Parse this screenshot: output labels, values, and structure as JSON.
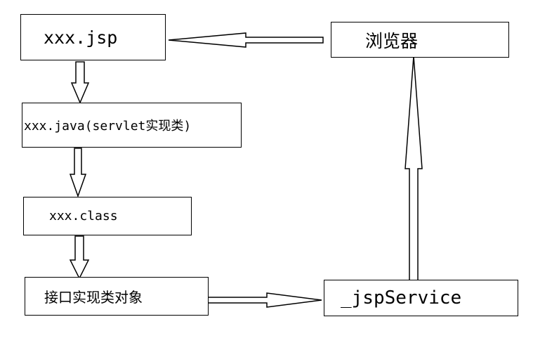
{
  "nodes": {
    "jsp": "xxx.jsp",
    "java": "xxx.java(servlet实现类)",
    "class": "xxx.class",
    "interface_object": "接口实现类对象",
    "browser": "浏览器",
    "jsp_service": "_jspService"
  },
  "colors": {
    "line": "#000000",
    "background": "#ffffff"
  }
}
